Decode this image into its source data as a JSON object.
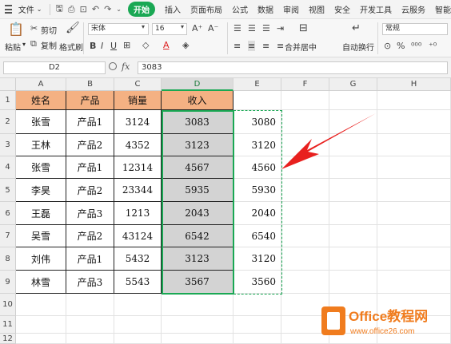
{
  "menubar": {
    "file_label": "文件",
    "tabs": [
      "开始",
      "插入",
      "页面布局",
      "公式",
      "数据",
      "审阅",
      "视图",
      "安全",
      "开发工具",
      "云服务",
      "智能"
    ],
    "active_tab": "开始"
  },
  "ribbon": {
    "paste_label": "粘贴",
    "cut_label": "剪切",
    "copy_label": "复制",
    "format_painter_label": "格式刷",
    "font_name": "宋体",
    "font_size": "16",
    "merge_label": "合并居中",
    "wrap_label": "自动换行",
    "number_format": "常规"
  },
  "formula_bar": {
    "cell_ref": "D2",
    "fx_label": "fx",
    "value": "3083"
  },
  "sheet": {
    "columns": [
      "A",
      "B",
      "C",
      "D",
      "E",
      "F",
      "G",
      "H"
    ],
    "selected_column": "D",
    "row_numbers": [
      "1",
      "2",
      "3",
      "4",
      "5",
      "6",
      "7",
      "8",
      "9",
      "10",
      "11",
      "12"
    ],
    "headers": [
      "姓名",
      "产品",
      "销量",
      "收入"
    ],
    "rows": [
      {
        "name": "张雪",
        "product": "产品1",
        "sales": "3124",
        "income": "3083",
        "e": "3080"
      },
      {
        "name": "王林",
        "product": "产品2",
        "sales": "4352",
        "income": "3123",
        "e": "3120"
      },
      {
        "name": "张雪",
        "product": "产品1",
        "sales": "12314",
        "income": "4567",
        "e": "4560"
      },
      {
        "name": "李昊",
        "product": "产品2",
        "sales": "23344",
        "income": "5935",
        "e": "5930"
      },
      {
        "name": "王磊",
        "product": "产品3",
        "sales": "1213",
        "income": "2043",
        "e": "2040"
      },
      {
        "name": "吴雪",
        "product": "产品2",
        "sales": "43124",
        "income": "6542",
        "e": "6540"
      },
      {
        "name": "刘伟",
        "product": "产品1",
        "sales": "5432",
        "income": "3123",
        "e": "3120"
      },
      {
        "name": "林雪",
        "product": "产品3",
        "sales": "5543",
        "income": "3567",
        "e": "3560"
      }
    ]
  },
  "watermark": {
    "title": "Office教程网",
    "url": "www.office26.com"
  },
  "colors": {
    "accent_green": "#1aa854",
    "header_fill": "#f4b183",
    "arrow_red": "#e8201e",
    "watermark_orange": "#f07c1e"
  }
}
